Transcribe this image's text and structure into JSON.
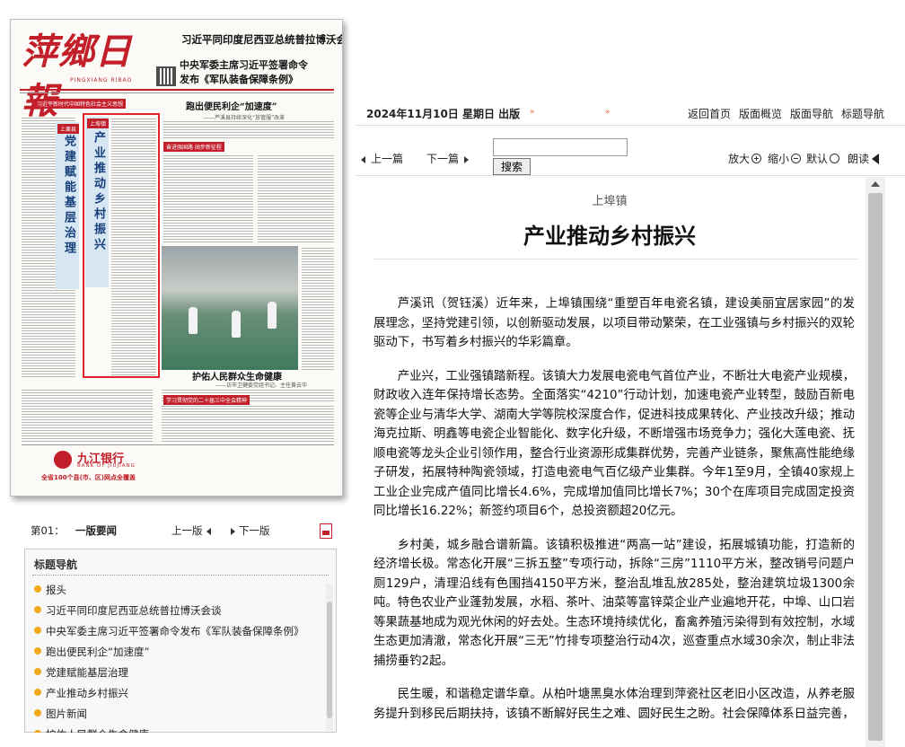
{
  "paper": {
    "masthead": "萍鄉日報",
    "masthead_pinyin": "PINGXIANG RIBAO",
    "headlines": {
      "h1": "习近平同印度尼西亚总统普拉博沃会谈",
      "h2": "中央军委主席习近平签署命令",
      "h3": "发布《军队装备保障条例》",
      "h4": "跑出便民利企“加速度”",
      "h5": "——芦溪县持续深化“放管服”改革",
      "h6": "护佑人民群众生命健康",
      "h7": "——访市卫健委党组书记、主任黄云华"
    },
    "bars": {
      "b1": "习近平新时代中国特色社会主义思想",
      "b2": "奋进强国路 阔步新征程",
      "b3": "学习贯彻党的二十届三中全会精神"
    },
    "vertical_left": "党建赋能基层治理",
    "vertical_right": "产业推动乡村振兴",
    "vtag_left": "上栗县",
    "vtag_right": "上埠镇",
    "bank_name": "九江银行",
    "bank_en": "BANK OF JIUJIANG",
    "bank_slogan": "全省100个县(市、区)网点全覆盖"
  },
  "pagebar": {
    "page_label": "第01：",
    "page_name": "一版要闻",
    "prev": "上一版",
    "next": "下一版"
  },
  "titlenav": {
    "heading": "标题导航",
    "items": [
      "报头",
      "习近平同印度尼西亚总统普拉博沃会谈",
      "中央军委主席习近平签署命令发布《军队装备保障条例》",
      "跑出便民利企“加速度”",
      "党建赋能基层治理",
      "产业推动乡村振兴",
      "图片新闻",
      "护佑人民群众生命健康"
    ]
  },
  "topbar": {
    "date": "2024年11月10日 星期日 出版",
    "links": [
      "返回首页",
      "版面概览",
      "版面导航",
      "标题导航"
    ]
  },
  "toolbar": {
    "prev": "上一篇",
    "next": "下一篇",
    "search_value": "",
    "search_btn": "搜索",
    "zoom_in": "放大",
    "zoom_out": "缩小",
    "zoom_default": "默认",
    "read": "朗读"
  },
  "article": {
    "subtitle": "上埠镇",
    "title": "产业推动乡村振兴",
    "paragraphs": [
      "芦溪讯（贺钰溪）近年来，上埠镇围绕“重塑百年电瓷名镇，建设美丽宜居家园”的发展理念，坚持党建引领，以创新驱动发展，以项目带动繁荣，在工业强镇与乡村振兴的双轮驱动下，书写着乡村振兴的华彩篇章。",
      "产业兴，工业强镇踏新程。该镇大力发展电瓷电气首位产业，不断壮大电瓷产业规模，财政收入连年保持增长态势。全面落实“4210”行动计划，加速电瓷产业转型，鼓励百新电瓷等企业与清华大学、湖南大学等院校深度合作，促进科技成果转化、产业技改升级；推动海克拉斯、明鑫等电瓷企业智能化、数字化升级，不断增强市场竞争力；强化大莲电瓷、抚顺电瓷等龙头企业引领作用，整合行业资源形成集群优势，完善产业链条，聚焦高性能绝缘子研发，拓展特种陶瓷领域，打造电瓷电气百亿级产业集群。今年1至9月，全镇40家规上工业企业完成产值同比增长4.6%，完成增加值同比增长7%；30个在库项目完成固定投资同比增长16.22%；新签约项目6个，总投资额超20亿元。",
      "乡村美，城乡融合谱新篇。该镇积极推进“两高一站”建设，拓展城镇功能，打造新的经济增长极。常态化开展“三拆五整”专项行动，拆除“三房”1110平方米，整改销号问题户厕129户，清理沿线有色围挡4150平方米，整治乱堆乱放285处，整治建筑垃圾1300余吨。特色农业产业蓬勃发展，水稻、茶叶、油菜等富锌菜企业产业遍地开花，中埠、山口岩等果蔬基地成为观光休闲的好去处。生态环境持续优化，畜禽养殖污染得到有效控制，水域生态更加清澈，常态化开展“三无”竹排专项整治行动4次，巡查重点水域30余次，制止非法捕捞垂钓2起。",
      "民生暖，和谐稳定谱华章。从柏叶塘黑臭水体治理到萍瓷社区老旧小区改造，从养老服务提升到移民后期扶持，该镇不断解好民生之难、圆好民生之盼。社会保障体系日益完善，"
    ]
  }
}
